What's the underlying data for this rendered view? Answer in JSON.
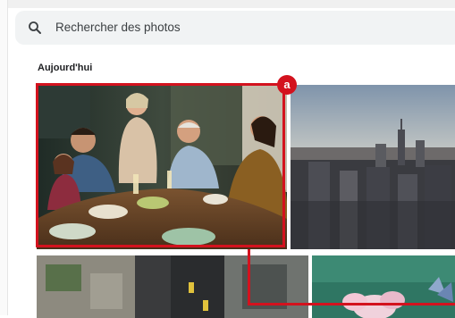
{
  "search": {
    "placeholder": "Rechercher des photos",
    "icon": "search-icon"
  },
  "gallery": {
    "section_title": "Aujourd'hui"
  },
  "annotation": {
    "badge_label": "a",
    "color": "#d3121e"
  }
}
